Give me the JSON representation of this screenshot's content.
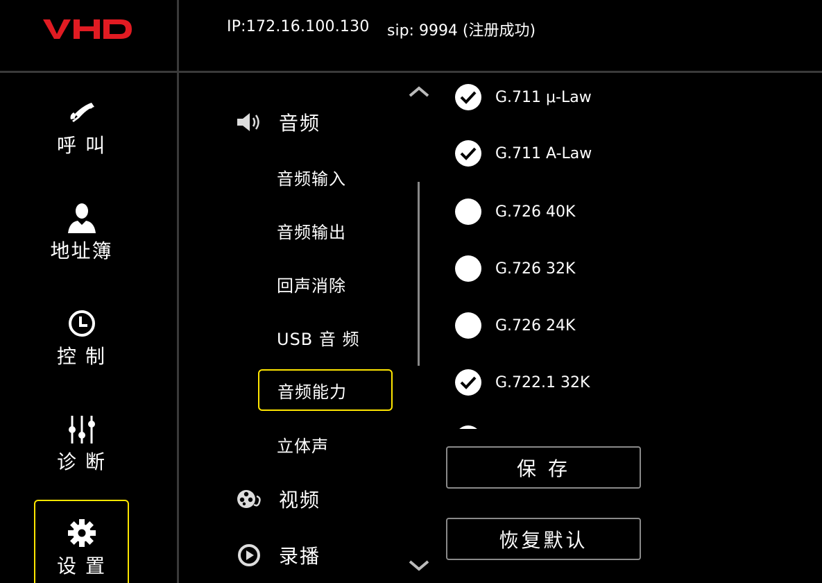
{
  "brand": {
    "logo_text": "VHD",
    "color": "#e11b22"
  },
  "header": {
    "ip": "IP:172.16.100.130",
    "sip": "sip: 9994 (注册成功)"
  },
  "nav": [
    {
      "key": "call",
      "label": "呼 叫",
      "icon": "phone-icon"
    },
    {
      "key": "contacts",
      "label": "地址簿",
      "icon": "person-icon"
    },
    {
      "key": "control",
      "label": "控 制",
      "icon": "clock-icon"
    },
    {
      "key": "diagnose",
      "label": "诊 断",
      "icon": "sliders-icon"
    },
    {
      "key": "settings",
      "label": "设 置",
      "icon": "gear-icon",
      "active": true
    }
  ],
  "menu": {
    "audio": {
      "label": "音频",
      "icon": "speaker-icon",
      "items": [
        "音频输入",
        "音频输出",
        "回声消除",
        "USB 音 频",
        "音频能力",
        "立体声"
      ],
      "selected": "音频能力"
    },
    "video": {
      "label": "视频",
      "icon": "film-reel-icon"
    },
    "record": {
      "label": "录播",
      "icon": "play-circle-icon"
    }
  },
  "codecs": [
    {
      "label": "G.711 μ-Law",
      "checked": true
    },
    {
      "label": "G.711 A-Law",
      "checked": true
    },
    {
      "label": "G.726 40K",
      "checked": false
    },
    {
      "label": "G.726 32K",
      "checked": false
    },
    {
      "label": "G.726 24K",
      "checked": false
    },
    {
      "label": "G.722.1 32K",
      "checked": true
    },
    {
      "label": "",
      "checked": false
    }
  ],
  "buttons": {
    "save": "保 存",
    "restore": "恢复默认"
  },
  "colors": {
    "accent": "#ffe600",
    "background": "#000000",
    "divider": "#3a3a3a"
  }
}
